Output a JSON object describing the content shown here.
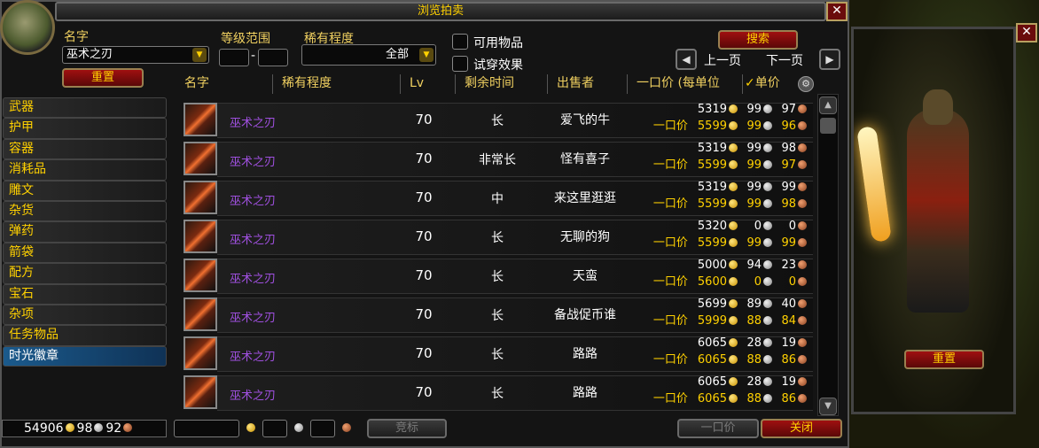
{
  "window": {
    "title": "浏览拍卖",
    "close_glyph": "✕"
  },
  "search": {
    "name_label": "名字",
    "name_value": "巫术之刃",
    "level_label": "等级范围",
    "level_min": "",
    "level_dash": "-",
    "level_max": "",
    "rarity_label": "稀有程度",
    "rarity_value": "全部",
    "usable_label": "可用物品",
    "tryon_label": "试穿效果",
    "reset_label": "重置",
    "search_label": "搜索",
    "prev_label": "上一页",
    "next_label": "下一页"
  },
  "columns": {
    "name": "名字",
    "rarity": "稀有程度",
    "level": "Lv",
    "time": "剩余时间",
    "seller": "出售者",
    "buyout": "一口价 (每单位",
    "unit": "单价",
    "unit_check": "✓"
  },
  "categories": [
    {
      "label": "武器"
    },
    {
      "label": "护甲"
    },
    {
      "label": "容器"
    },
    {
      "label": "消耗品"
    },
    {
      "label": "雕文"
    },
    {
      "label": "杂货"
    },
    {
      "label": "弹药"
    },
    {
      "label": "箭袋"
    },
    {
      "label": "配方"
    },
    {
      "label": "宝石"
    },
    {
      "label": "杂项"
    },
    {
      "label": "任务物品"
    },
    {
      "label": "时光徽章"
    }
  ],
  "active_category": "时光徽章",
  "buyout_prefix": "一口价",
  "rows": [
    {
      "name": "巫术之刃",
      "level": "70",
      "time": "长",
      "seller": "爱飞的牛",
      "bid": {
        "g": "5319",
        "s": "99",
        "c": "97"
      },
      "buyout": {
        "g": "5599",
        "s": "99",
        "c": "96"
      }
    },
    {
      "name": "巫术之刃",
      "level": "70",
      "time": "非常长",
      "seller": "怪有喜子",
      "bid": {
        "g": "5319",
        "s": "99",
        "c": "98"
      },
      "buyout": {
        "g": "5599",
        "s": "99",
        "c": "97"
      }
    },
    {
      "name": "巫术之刃",
      "level": "70",
      "time": "中",
      "seller": "来这里逛逛",
      "bid": {
        "g": "5319",
        "s": "99",
        "c": "99"
      },
      "buyout": {
        "g": "5599",
        "s": "99",
        "c": "98"
      }
    },
    {
      "name": "巫术之刃",
      "level": "70",
      "time": "长",
      "seller": "无聊的狗",
      "bid": {
        "g": "5320",
        "s": "0",
        "c": "0"
      },
      "buyout": {
        "g": "5599",
        "s": "99",
        "c": "99"
      }
    },
    {
      "name": "巫术之刃",
      "level": "70",
      "time": "长",
      "seller": "天蛮",
      "bid": {
        "g": "5000",
        "s": "94",
        "c": "23"
      },
      "buyout": {
        "g": "5600",
        "s": "0",
        "c": "0"
      }
    },
    {
      "name": "巫术之刃",
      "level": "70",
      "time": "长",
      "seller": "备战促币谁",
      "bid": {
        "g": "5699",
        "s": "89",
        "c": "40"
      },
      "buyout": {
        "g": "5999",
        "s": "88",
        "c": "84"
      }
    },
    {
      "name": "巫术之刃",
      "level": "70",
      "time": "长",
      "seller": "路路",
      "bid": {
        "g": "6065",
        "s": "28",
        "c": "19"
      },
      "buyout": {
        "g": "6065",
        "s": "88",
        "c": "86"
      }
    },
    {
      "name": "巫术之刃",
      "level": "70",
      "time": "长",
      "seller": "路路",
      "bid": {
        "g": "6065",
        "s": "28",
        "c": "19"
      },
      "buyout": {
        "g": "6065",
        "s": "88",
        "c": "86"
      }
    }
  ],
  "footer": {
    "money": {
      "g": "54906",
      "s": "98",
      "c": "92"
    },
    "bid_label": "竞标",
    "buyout_label": "一口价",
    "close_label": "关闭"
  },
  "preview": {
    "reset_label": "重置"
  },
  "colors": {
    "epic": "#a050e0",
    "gold_text": "#ffd100",
    "selected": "#1b5a8c"
  }
}
